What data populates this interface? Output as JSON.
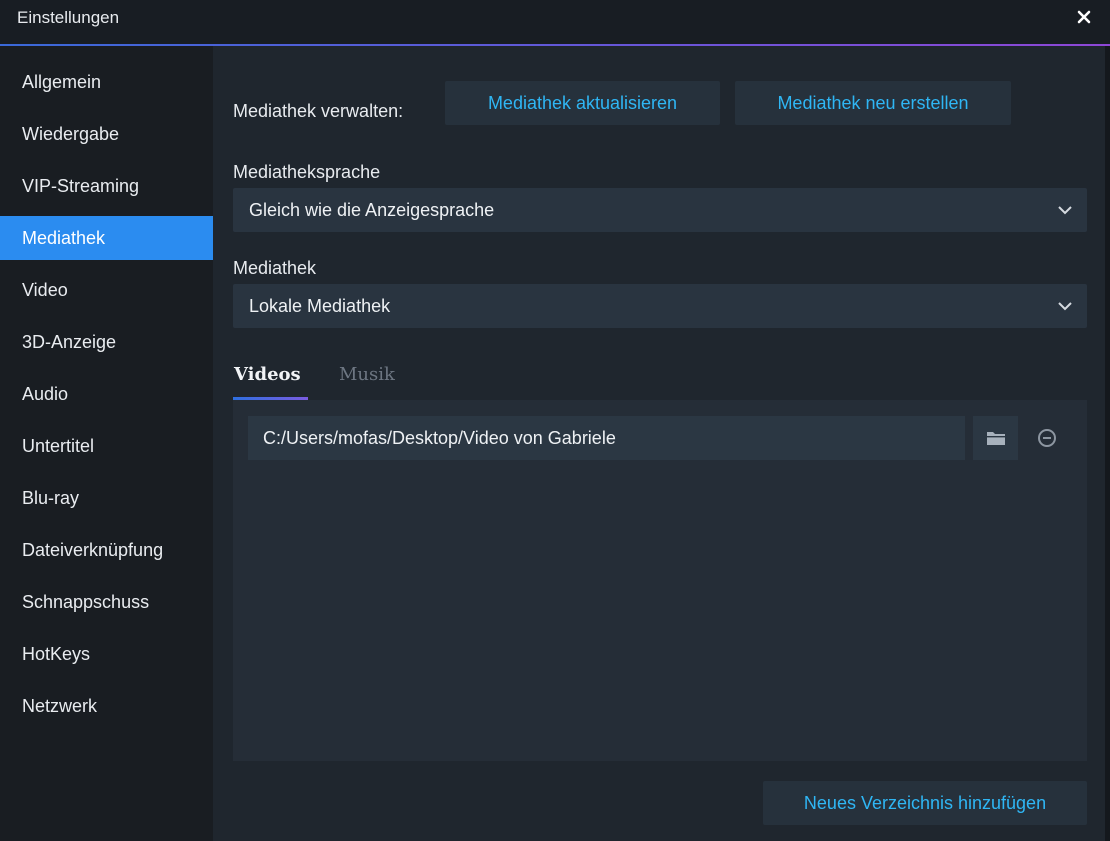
{
  "window": {
    "title": "Einstellungen"
  },
  "sidebar": {
    "items": [
      {
        "label": "Allgemein"
      },
      {
        "label": "Wiedergabe"
      },
      {
        "label": "VIP-Streaming"
      },
      {
        "label": "Mediathek",
        "active": true
      },
      {
        "label": "Video"
      },
      {
        "label": "3D-Anzeige"
      },
      {
        "label": "Audio"
      },
      {
        "label": "Untertitel"
      },
      {
        "label": "Blu-ray"
      },
      {
        "label": "Dateiverknüpfung"
      },
      {
        "label": "Schnappschuss"
      },
      {
        "label": "HotKeys"
      },
      {
        "label": "Netzwerk"
      }
    ]
  },
  "main": {
    "manage_label": "Mediathek verwalten:",
    "refresh_button": "Mediathek aktualisieren",
    "rebuild_button": "Mediathek neu erstellen",
    "language_label": "Mediatheksprache",
    "language_value": "Gleich wie die Anzeigesprache",
    "library_label": "Mediathek",
    "library_value": "Lokale Mediathek",
    "tabs": [
      {
        "label": "Videos",
        "active": true
      },
      {
        "label": "Musik"
      }
    ],
    "folders": [
      {
        "path": "C:/Users/mofas/Desktop/Video von Gabriele"
      }
    ],
    "add_folder_button": "Neues Verzeichnis hinzufügen"
  },
  "icons": {
    "close": "close-icon",
    "chevron": "chevron-down-icon",
    "folder": "folder-icon",
    "remove": "remove-circle-icon"
  },
  "colors": {
    "accent": "#2b8cf0",
    "link": "#2fb6f4"
  }
}
